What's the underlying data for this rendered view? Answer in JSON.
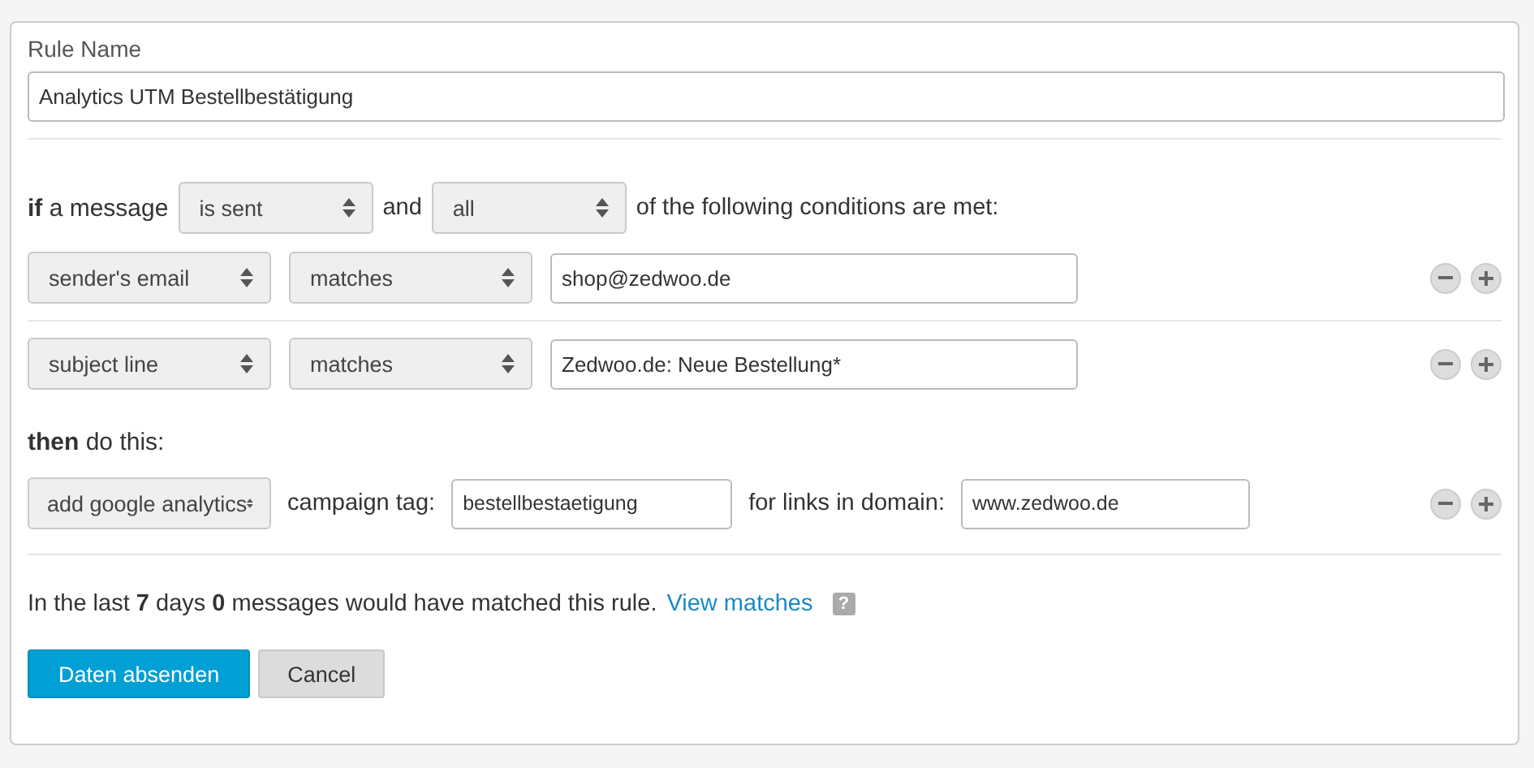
{
  "rule_name": {
    "label": "Rule Name",
    "value": "Analytics UTM Bestellbestätigung"
  },
  "condition_intro": {
    "lead": "**if** a message",
    "event_select": "is sent",
    "conjunction": "and",
    "match_select": "all",
    "trailing": "of the following conditions are met:"
  },
  "conditions": [
    {
      "field": "sender's email",
      "operator": "matches",
      "value": "shop@zedwoo.de"
    },
    {
      "field": "subject line",
      "operator": "matches",
      "value": "Zedwoo.de: Neue Bestellung*"
    }
  ],
  "action_intro": "**then** do this:",
  "actions": [
    {
      "action": "add google analytics",
      "campaign_label": "campaign tag:",
      "campaign_value": "bestellbestaetigung",
      "domain_label": "for links in domain:",
      "domain_value": "www.zedwoo.de"
    }
  ],
  "summary": {
    "text": "In the last **7** days **0** messages would have matched this rule.",
    "link": "View matches",
    "help": "?"
  },
  "buttons": [
    {
      "label": "Daten absenden",
      "kind": "primary"
    },
    {
      "label": "Cancel",
      "kind": "secondary"
    }
  ]
}
